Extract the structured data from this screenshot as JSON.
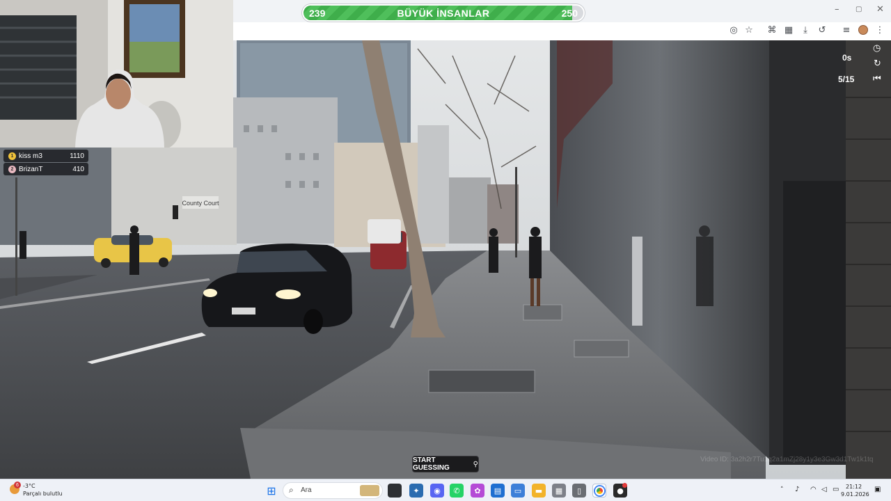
{
  "game": {
    "level_current": "239",
    "level_next": "250",
    "title": "BÜYÜK İNSANLAR",
    "progress_fraction": 0.96,
    "timer": "0s",
    "round": "5/15",
    "guess_button": "START GUESSING",
    "video_id": "Video ID: 3a2h2r7Tu1q2a1mZj28y1y3e3Gw3d1Tw1k1tq"
  },
  "leaderboard": [
    {
      "rank": "1",
      "name": "kiss m3",
      "score": "1110",
      "badge_color": "#f0c23a"
    },
    {
      "rank": "2",
      "name": "BrizanT",
      "score": "410",
      "badge_color": "#e8b8c0"
    }
  ],
  "scene_text": {
    "building_sign": "County Court"
  },
  "browser": {
    "toolbar_icons": [
      "eye-off-icon",
      "star-icon",
      "translate-icon",
      "qr-icon",
      "download-icon",
      "history-icon",
      "playlist-icon",
      "profile-avatar",
      "more-icon"
    ],
    "window_controls": [
      "minimize",
      "maximize",
      "close"
    ]
  },
  "taskbar": {
    "weather_temp": "-3°C",
    "weather_desc": "Parçalı bulutlu",
    "weather_badge": "6",
    "search_placeholder": "Ara",
    "time": "21:12",
    "date": "9.01.2026"
  },
  "colors": {
    "progress_green": "#3fae4b",
    "hud_bg": "#121214"
  }
}
